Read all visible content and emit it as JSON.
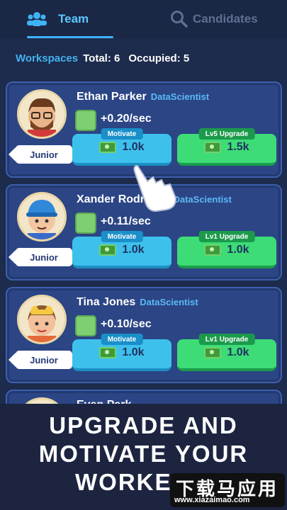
{
  "tabs": {
    "team": {
      "label": "Team",
      "icon": "team-icon"
    },
    "candidates": {
      "label": "Candidates",
      "icon": "search-icon"
    }
  },
  "summary": {
    "workspaces_label": "Workspaces",
    "total": "Total: 6",
    "occupied": "Occupied: 5"
  },
  "workers": [
    {
      "name": "Ethan Parker",
      "role": "DataScientist",
      "rate": "+0.20/sec",
      "rank": "Junior",
      "motivate_label": "Motivate",
      "motivate_cost": "1.0k",
      "upgrade_label": "Lv5 Upgrade",
      "upgrade_cost": "1.5k"
    },
    {
      "name": "Xander Rodri",
      "role": "DataScientist",
      "rate": "+0.11/sec",
      "rank": "Junior",
      "motivate_label": "Motivate",
      "motivate_cost": "1.0k",
      "upgrade_label": "Lv1 Upgrade",
      "upgrade_cost": "1.0k"
    },
    {
      "name": "Tina Jones",
      "role": "DataScientist",
      "rate": "+0.10/sec",
      "rank": "Junior",
      "motivate_label": "Motivate",
      "motivate_cost": "1.0k",
      "upgrade_label": "Lv1 Upgrade",
      "upgrade_cost": "1.0k"
    },
    {
      "name": "Evan Park"
    }
  ],
  "banner": {
    "line1": "UPGRADE AND",
    "line2": "MOTIVATE YOUR",
    "line3": "WORKE"
  },
  "watermark": {
    "title": "下载马应用",
    "url": "www.xiazaimao.com"
  },
  "colors": {
    "background": "#1d2b4c",
    "card": "#2b4585",
    "accent_blue": "#3dc1ec",
    "accent_green": "#3ddc77"
  }
}
